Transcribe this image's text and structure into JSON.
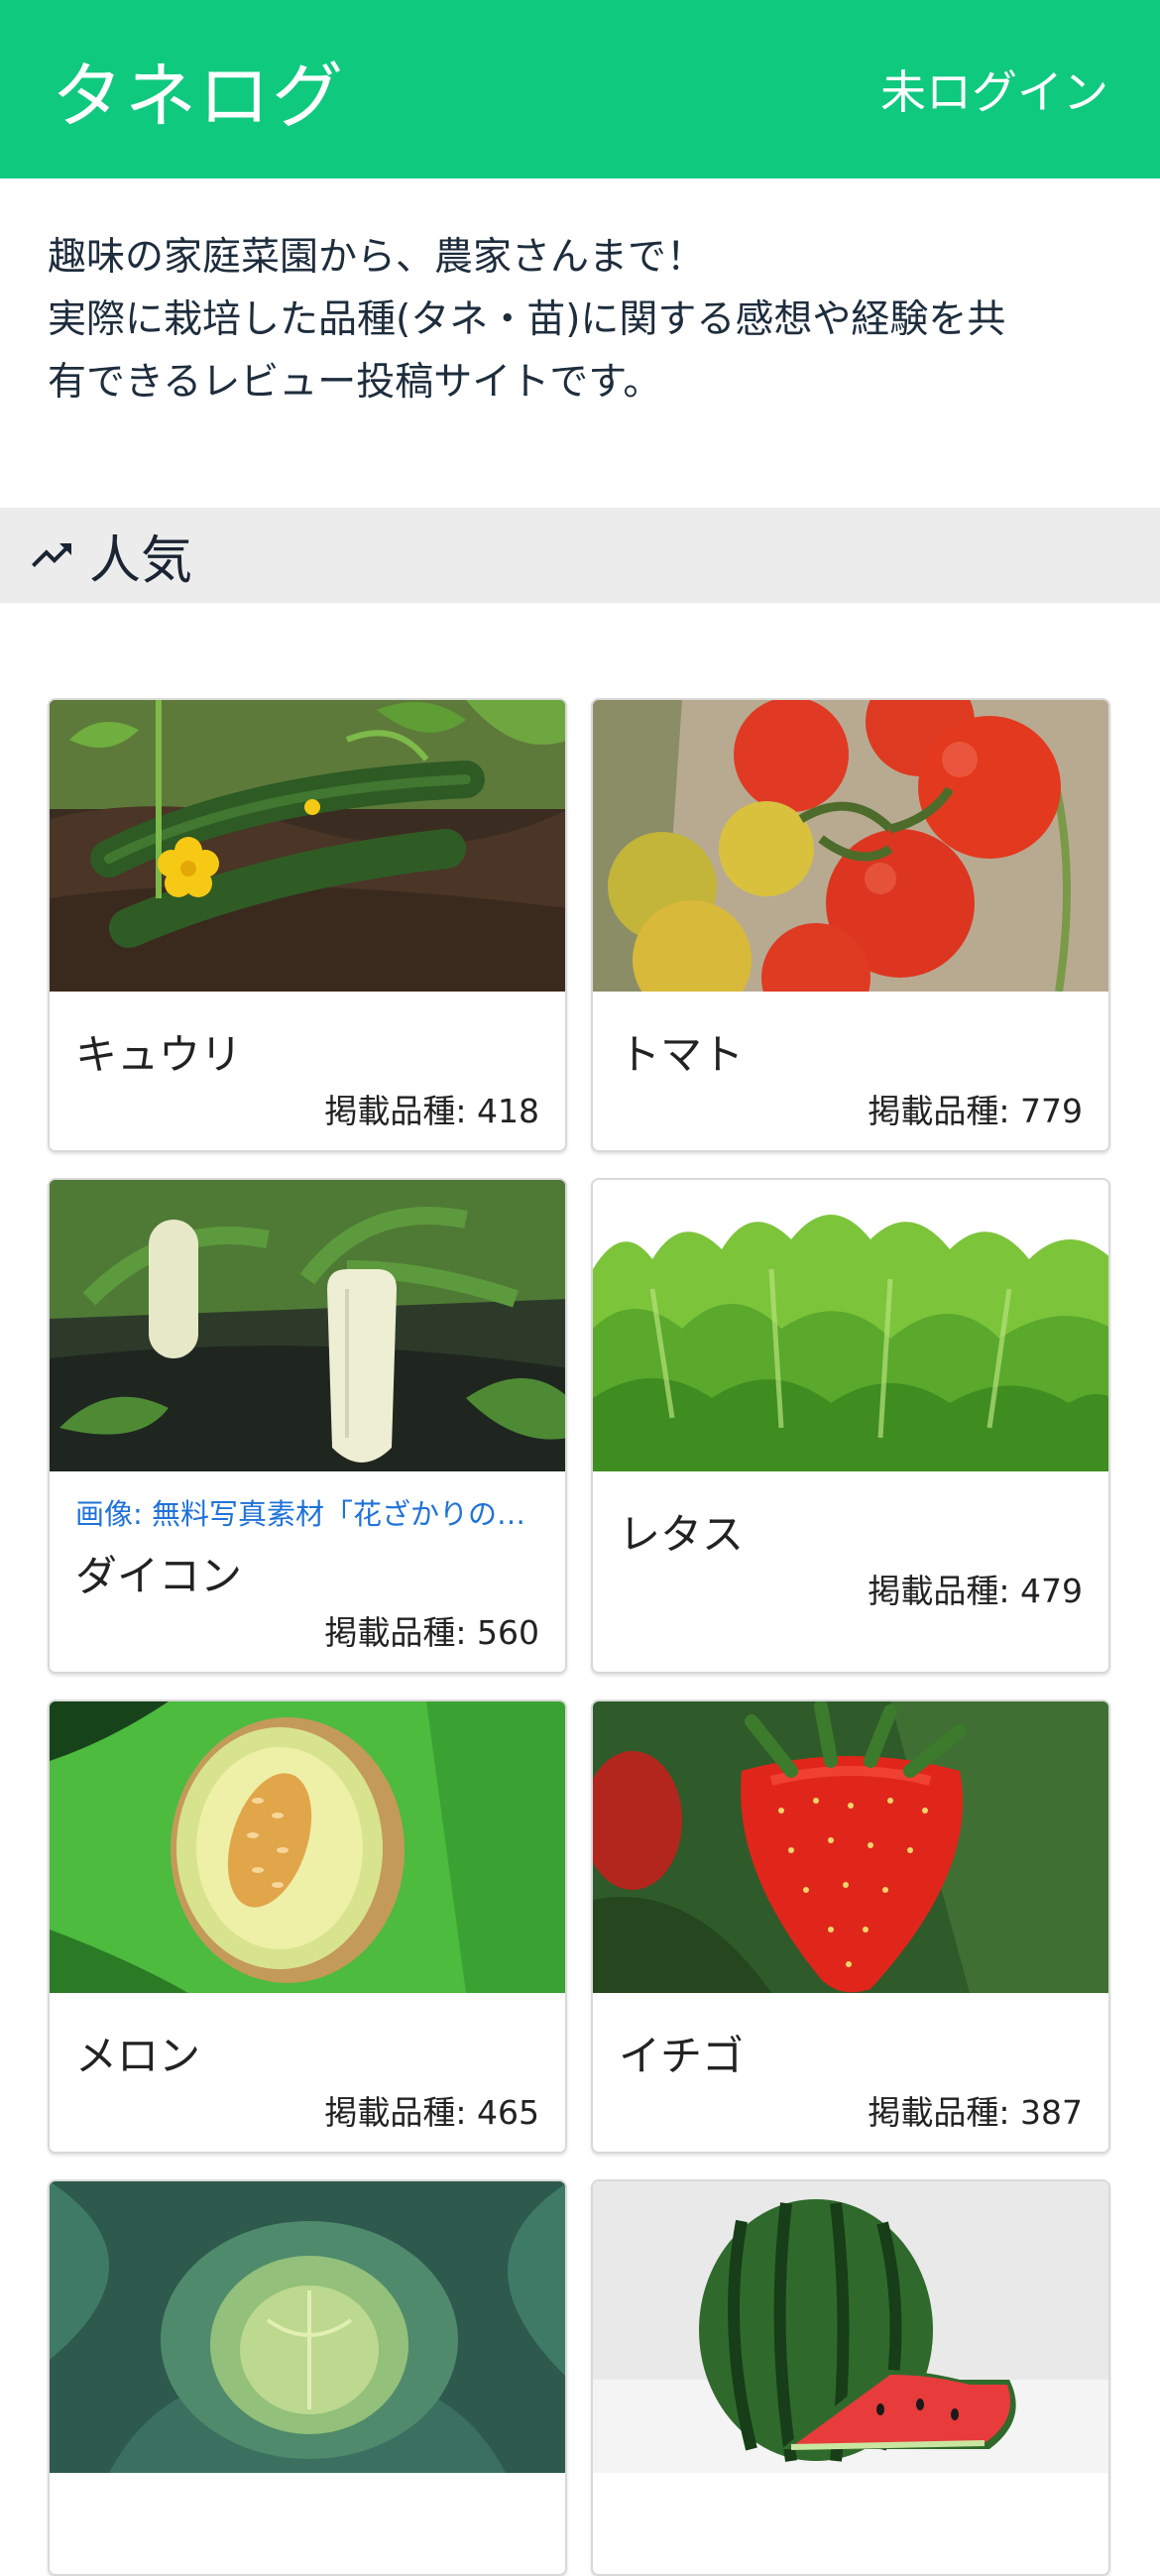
{
  "header": {
    "logo": "タネログ",
    "login": "未ログイン"
  },
  "intro": {
    "line1": "趣味の家庭菜園から、農家さんまで！",
    "line2": "実際に栽培した品種(タネ・苗)に関する感想や経験を共",
    "line3": "有できるレビュー投稿サイトです。"
  },
  "section": {
    "title": "人気",
    "icon": "trending-up-icon"
  },
  "cards": [
    {
      "name": "キュウリ",
      "count": "掲載品種: 418"
    },
    {
      "name": "トマト",
      "count": "掲載品種: 779"
    },
    {
      "name": "ダイコン",
      "count": "掲載品種: 560",
      "credit": "画像: 無料写真素材「花ざかりの…"
    },
    {
      "name": "レタス",
      "count": "掲載品種: 479"
    },
    {
      "name": "メロン",
      "count": "掲載品種: 465"
    },
    {
      "name": "イチゴ",
      "count": "掲載品種: 387"
    },
    {
      "name": "",
      "count": ""
    },
    {
      "name": "",
      "count": ""
    }
  ],
  "colors": {
    "brand": "#0fc97f",
    "link": "#1f72d8"
  }
}
